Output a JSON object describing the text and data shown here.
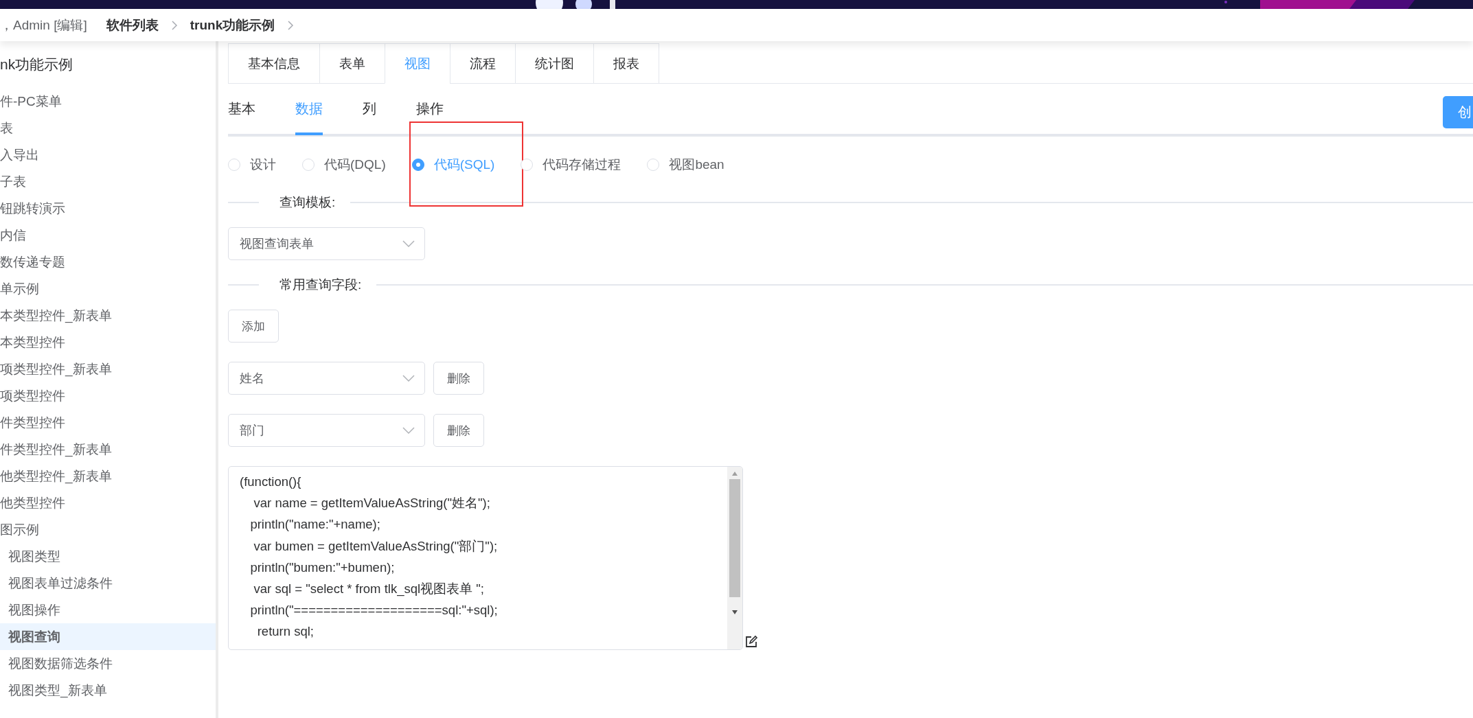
{
  "breadcrumb": {
    "user": "，Admin [编辑]",
    "items": [
      "软件列表",
      "trunk功能示例"
    ]
  },
  "sidebar": {
    "title": "nk功能示例",
    "items": [
      {
        "label": "件-PC菜单",
        "selected": false
      },
      {
        "label": "表",
        "selected": false
      },
      {
        "label": "入导出",
        "selected": false
      },
      {
        "label": "子表",
        "selected": false
      },
      {
        "label": "钮跳转演示",
        "selected": false
      },
      {
        "label": "内信",
        "selected": false
      },
      {
        "label": "数传递专题",
        "selected": false
      },
      {
        "label": "单示例",
        "selected": false
      },
      {
        "label": "本类型控件_新表单",
        "selected": false
      },
      {
        "label": "本类型控件",
        "selected": false
      },
      {
        "label": "项类型控件_新表单",
        "selected": false
      },
      {
        "label": "项类型控件",
        "selected": false
      },
      {
        "label": "件类型控件",
        "selected": false
      },
      {
        "label": "件类型控件_新表单",
        "selected": false
      },
      {
        "label": "他类型控件_新表单",
        "selected": false
      },
      {
        "label": "他类型控件",
        "selected": false
      },
      {
        "label": "图示例",
        "selected": false,
        "children": [
          {
            "label": "视图类型",
            "selected": false
          },
          {
            "label": "视图表单过滤条件",
            "selected": false
          },
          {
            "label": "视图操作",
            "selected": false
          },
          {
            "label": "视图查询",
            "selected": true
          },
          {
            "label": "视图数据筛选条件",
            "selected": false
          },
          {
            "label": "视图类型_新表单",
            "selected": false
          }
        ]
      }
    ]
  },
  "tabs": [
    {
      "label": "基本信息",
      "selected": false
    },
    {
      "label": "表单",
      "selected": false
    },
    {
      "label": "视图",
      "selected": true
    },
    {
      "label": "流程",
      "selected": false
    },
    {
      "label": "统计图",
      "selected": false
    },
    {
      "label": "报表",
      "selected": false
    }
  ],
  "subtabs": [
    {
      "label": "基本",
      "selected": false
    },
    {
      "label": "数据",
      "selected": true
    },
    {
      "label": "列",
      "selected": false
    },
    {
      "label": "操作",
      "selected": false
    }
  ],
  "create_button": "创",
  "source_options": [
    {
      "label": "设计",
      "selected": false,
      "annotated": false
    },
    {
      "label": "代码(DQL)",
      "selected": false,
      "annotated": false
    },
    {
      "label": "代码(SQL)",
      "selected": true,
      "annotated": true
    },
    {
      "label": "代码存储过程",
      "selected": false,
      "annotated": false
    },
    {
      "label": "视图bean",
      "selected": false,
      "annotated": false
    }
  ],
  "template_section": {
    "label": "查询模板:",
    "select": "视图查询表单"
  },
  "fields_section": {
    "label": "常用查询字段:",
    "add_button": "添加",
    "fields": [
      {
        "value": "姓名",
        "delete_button": "删除"
      },
      {
        "value": "部门",
        "delete_button": "删除"
      }
    ]
  },
  "code": {
    "lines": [
      "(function(){",
      "    var name = getItemValueAsString(\"姓名\");",
      "   println(\"name:\"+name);",
      "    var bumen = getItemValueAsString(\"部门\");",
      "   println(\"bumen:\"+bumen);",
      "    var sql = \"select * from tlk_sql视图表单 \";",
      "   println(\"====================sql:\"+sql);",
      "     return sql;"
    ]
  }
}
